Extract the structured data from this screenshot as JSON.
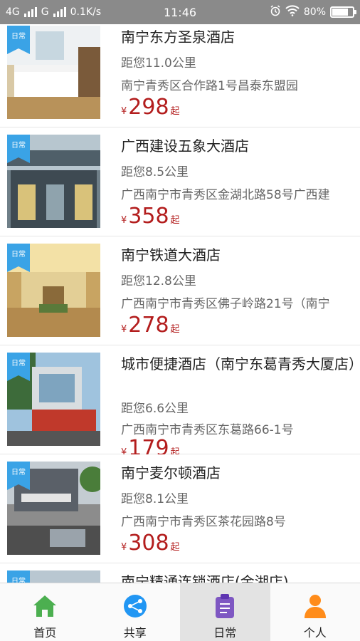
{
  "status_bar": {
    "network_left": "4G",
    "network_right": "G",
    "speed": "0.1K/s",
    "time": "11:46",
    "battery": "80%",
    "battery_level": 0.8
  },
  "hotels": [
    {
      "tag": "日常",
      "name": "南宁东方圣泉酒店",
      "distance": "距您11.0公里",
      "address": "南宁青秀区合作路1号昌泰东盟园",
      "currency": "¥",
      "price": "298",
      "suffix": "起"
    },
    {
      "tag": "日常",
      "name": "广西建设五象大酒店",
      "distance": "距您8.5公里",
      "address": "广西南宁市青秀区金湖北路58号广西建",
      "currency": "¥",
      "price": "358",
      "suffix": "起"
    },
    {
      "tag": "日常",
      "name": "南宁铁道大酒店",
      "distance": "距您12.8公里",
      "address": "广西南宁市青秀区佛子岭路21号（南宁",
      "currency": "¥",
      "price": "278",
      "suffix": "起"
    },
    {
      "tag": "日常",
      "name": "城市便捷酒店（南宁东葛青秀大厦店）",
      "distance": "距您6.6公里",
      "address": "广西南宁市青秀区东葛路66-1号",
      "currency": "¥",
      "price": "179",
      "suffix": "起"
    },
    {
      "tag": "日常",
      "name": "南宁麦尔顿酒店",
      "distance": "距您8.1公里",
      "address": "广西南宁市青秀区茶花园路8号",
      "currency": "¥",
      "price": "308",
      "suffix": "起"
    },
    {
      "tag": "日常",
      "name": "南宁精通连锁酒店(金湖店)",
      "distance": "",
      "address": "",
      "currency": "",
      "price": "",
      "suffix": ""
    }
  ],
  "tabbar": {
    "items": [
      {
        "label": "首页",
        "icon": "home-icon",
        "color": "#4caf50"
      },
      {
        "label": "共享",
        "icon": "share-icon",
        "color": "#2196f3"
      },
      {
        "label": "日常",
        "icon": "clipboard-icon",
        "color": "#7e57c2"
      },
      {
        "label": "个人",
        "icon": "person-icon",
        "color": "#ff8c1a"
      }
    ],
    "active": "日常"
  },
  "colors": {
    "price": "#b31d1d",
    "tag": "#3aa3e6",
    "statusbar": "#8a8a8a"
  }
}
